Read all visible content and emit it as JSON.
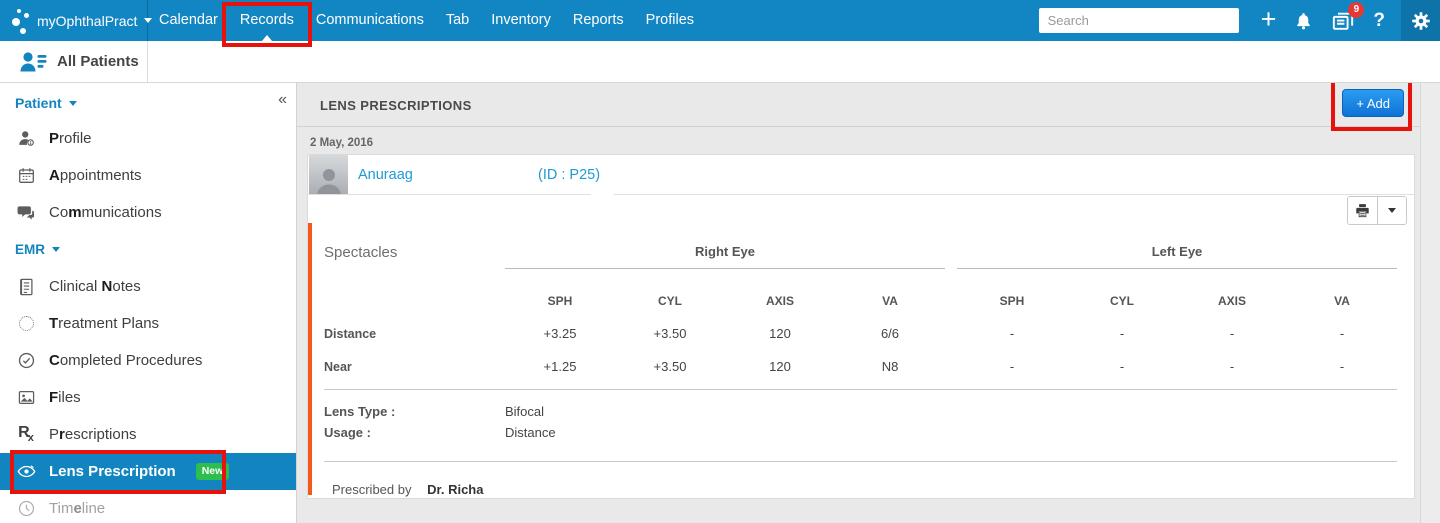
{
  "colors": {
    "navbar_blue": "#1286c2",
    "link_blue": "#1e9ad6",
    "highlight_red": "#e8120c",
    "new_badge_green": "#2ebd4f",
    "accent_orange": "#f4581c",
    "add_button_blue": "#0f72d6"
  },
  "navbar": {
    "brand": "myOphthalPract",
    "items": [
      "Calendar",
      "Records",
      "Communications",
      "Tab",
      "Inventory",
      "Reports",
      "Profiles"
    ],
    "active_item": "Records",
    "search_placeholder": "Search",
    "badge_count": "9",
    "icons": {
      "plus": "+",
      "help": "?"
    }
  },
  "subnav": {
    "tab_label": "All Patients"
  },
  "sidebar": {
    "section_patient": "Patient",
    "section_emr": "EMR",
    "collapse_glyph": "«",
    "rx_icon": {
      "main": "R",
      "sub": "x"
    },
    "items": [
      {
        "pre": "",
        "key": "P",
        "post": "rofile"
      },
      {
        "pre": "",
        "key": "A",
        "post": "ppointments"
      },
      {
        "pre": "Co",
        "key": "m",
        "post": "munications"
      },
      {
        "pre": "Clinical ",
        "key": "N",
        "post": "otes"
      },
      {
        "pre": "",
        "key": "T",
        "post": "reatment Plans"
      },
      {
        "pre": "",
        "key": "C",
        "post": "ompleted Procedures"
      },
      {
        "pre": "",
        "key": "F",
        "post": "iles"
      },
      {
        "pre": "P",
        "key": "r",
        "post": "escriptions"
      },
      {
        "pre": "",
        "key": "L",
        "post": "ens Prescription"
      },
      {
        "pre": "Tim",
        "key": "e",
        "post": "line"
      }
    ],
    "new_badge": "New"
  },
  "main": {
    "title": "LENS PRESCRIPTIONS",
    "add_button": "+ Add",
    "date": "2 May, 2016",
    "patient": {
      "name": "Anuraag",
      "id": "(ID : P25)"
    },
    "section_label": "Spectacles",
    "groups": [
      "Right Eye",
      "Left Eye"
    ],
    "col_headers": [
      "SPH",
      "CYL",
      "AXIS",
      "VA"
    ],
    "rows": [
      {
        "label": "Distance",
        "right": [
          "+3.25",
          "+3.50",
          "120",
          "6/6"
        ],
        "left": [
          "-",
          "-",
          "-",
          "-"
        ]
      },
      {
        "label": "Near",
        "right": [
          "+1.25",
          "+3.50",
          "120",
          "N8"
        ],
        "left": [
          "-",
          "-",
          "-",
          "-"
        ]
      }
    ],
    "details": [
      {
        "label": "Lens Type :",
        "value": "Bifocal"
      },
      {
        "label": "Usage :",
        "value": "Distance"
      }
    ],
    "prescribed_by_label": "Prescribed by",
    "prescribed_by_value": "Dr. Richa"
  }
}
